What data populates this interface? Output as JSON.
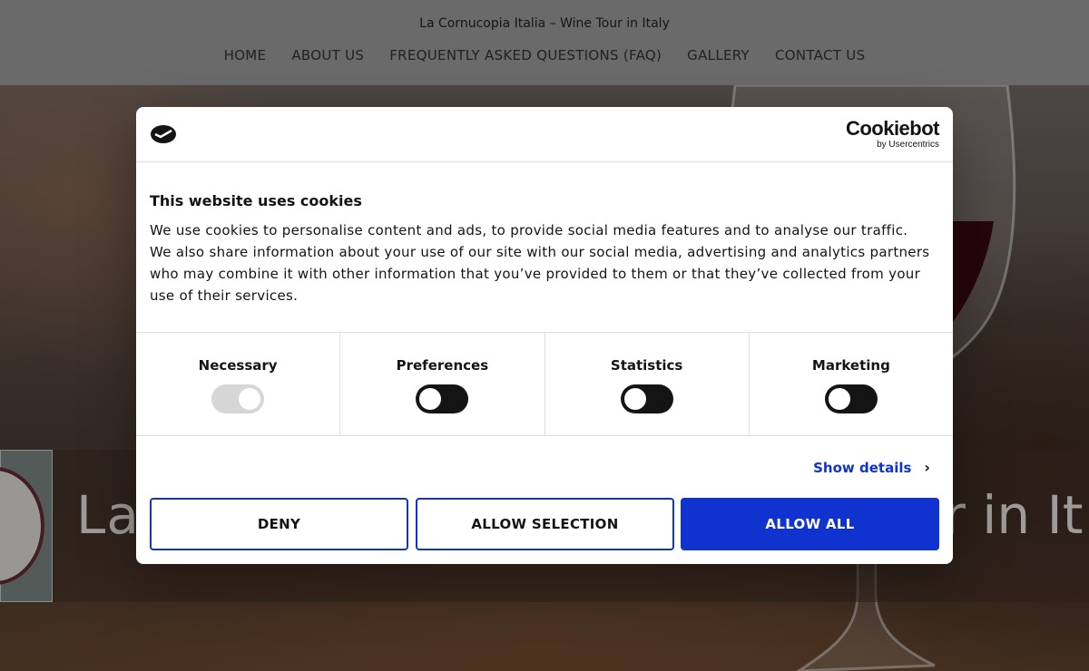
{
  "site": {
    "title": "La Cornucopia Italia – Wine Tour in Italy",
    "nav": [
      "HOME",
      "ABOUT US",
      "FREQUENTLY ASKED QUESTIONS (FAQ)",
      "GALLERY",
      "CONTACT US"
    ]
  },
  "hero": {
    "headline_left": "La",
    "headline_right": "r in It"
  },
  "cookie_dialog": {
    "brand_name": "Cookiebot",
    "brand_sub": "by Usercentrics",
    "title": "This website uses cookies",
    "text": "We use cookies to personalise content and ads, to provide social media features and to analyse our traffic. We also share information about your use of our site with our social media, advertising and analytics partners who may combine it with other information that you’ve provided to them or that they’ve collected from your use of their services.",
    "toggles": [
      {
        "label": "Necessary",
        "state": "on-disabled"
      },
      {
        "label": "Preferences",
        "state": "off"
      },
      {
        "label": "Statistics",
        "state": "off"
      },
      {
        "label": "Marketing",
        "state": "off"
      }
    ],
    "show_details": "Show details",
    "buttons": {
      "deny": "DENY",
      "allow_selection": "ALLOW SELECTION",
      "allow_all": "ALLOW ALL"
    },
    "colors": {
      "accent": "#1032cf",
      "text": "#141414"
    }
  }
}
